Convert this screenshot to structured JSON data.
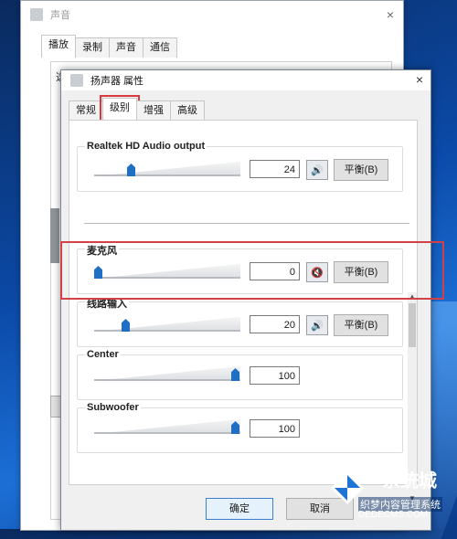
{
  "back_window": {
    "title": "声音",
    "close": "×",
    "tabs": [
      "播放",
      "录制",
      "声音",
      "通信"
    ],
    "stub_text": "选"
  },
  "front_window": {
    "title": "扬声器 属性",
    "close": "×",
    "tabs": [
      "常规",
      "级别",
      "增强",
      "高级"
    ],
    "active_tab": "级别"
  },
  "levels": [
    {
      "name": "Realtek HD Audio output",
      "value": "24",
      "level": 0.24,
      "muted": false,
      "balance_label": "平衡(B)"
    },
    {
      "name": "麦克风",
      "value": "0",
      "level": 0.0,
      "muted": true,
      "balance_label": "平衡(B)"
    },
    {
      "name": "线路输入",
      "value": "20",
      "level": 0.2,
      "muted": false,
      "balance_label": "平衡(B)"
    },
    {
      "name": "Center",
      "value": "100",
      "level": 1.0
    },
    {
      "name": "Subwoofer",
      "value": "100",
      "level": 1.0
    }
  ],
  "buttons": {
    "ok": "确定",
    "cancel": "取消"
  },
  "watermark": {
    "title": "系统城",
    "sub": "织梦内容管理系统",
    "url": "DEDECMS.COM"
  },
  "colors": {
    "highlight": "#d24048",
    "slider_thumb": "#1f6fc4",
    "desktop": "#0b4aa8"
  },
  "icons": {
    "speaker": "speaker-icon",
    "mute": "muted-speaker-icon",
    "close": "close-icon"
  }
}
